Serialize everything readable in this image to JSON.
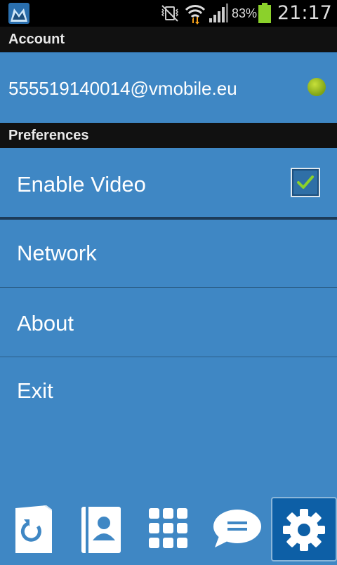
{
  "status_bar": {
    "battery_percent": "83%",
    "time": "21:17"
  },
  "account": {
    "header": "Account",
    "address": "555519140014@vmobile.eu",
    "status_color": "#9cc81f"
  },
  "preferences": {
    "header": "Preferences",
    "items": [
      {
        "label": "Enable Video",
        "checked": true
      },
      {
        "label": "Network"
      },
      {
        "label": "About"
      },
      {
        "label": "Exit"
      }
    ]
  },
  "bottom_nav": {
    "items": [
      {
        "icon": "call-history-icon"
      },
      {
        "icon": "contacts-icon"
      },
      {
        "icon": "dialpad-icon"
      },
      {
        "icon": "chat-icon"
      },
      {
        "icon": "settings-icon",
        "active": true
      }
    ]
  },
  "colors": {
    "background": "#3f87c4",
    "header_bg": "#111111",
    "active_tab": "#0d5fa6"
  }
}
